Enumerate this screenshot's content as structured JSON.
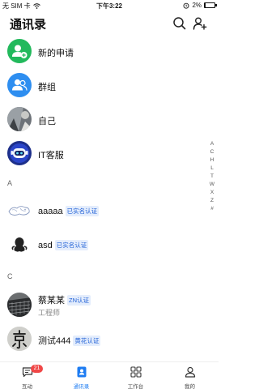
{
  "status_bar": {
    "carrier": "无 SIM 卡",
    "time": "下午3:22",
    "battery": "2%"
  },
  "header": {
    "title": "通讯录"
  },
  "quick_entries": [
    {
      "label": "新的申请",
      "icon": "add-person-icon",
      "color": "#22b95c"
    },
    {
      "label": "群组",
      "icon": "group-icon",
      "color": "#2e8ef0"
    },
    {
      "label": "自己",
      "icon": "photo-avatar"
    },
    {
      "label": "IT客服",
      "icon": "robot-avatar"
    }
  ],
  "sections": [
    {
      "letter": "A",
      "contacts": [
        {
          "name": "aaaaa",
          "tag": "已实名认证",
          "avatar": "sketch-avatar"
        },
        {
          "name": "asd",
          "tag": "已实名认证",
          "avatar": "penguin-avatar"
        }
      ]
    },
    {
      "letter": "C",
      "contacts": [
        {
          "name": "蔡某某",
          "tag": "ZN认证",
          "subtitle": "工程师",
          "avatar": "keyboard-photo-avatar"
        },
        {
          "name": "测试444",
          "tag": "黄花认证",
          "avatar": "jing-character-avatar"
        }
      ]
    }
  ],
  "index_letters": [
    "A",
    "C",
    "H",
    "L",
    "T",
    "W",
    "X",
    "Z",
    "#"
  ],
  "tab_bar": [
    {
      "label": "互动",
      "icon": "chat-icon",
      "badge": "21"
    },
    {
      "label": "通讯录",
      "icon": "contacts-icon",
      "active": true
    },
    {
      "label": "工作台",
      "icon": "grid-icon"
    },
    {
      "label": "我的",
      "icon": "person-icon"
    }
  ],
  "colors": {
    "accent": "#1e7cf2",
    "tag_text": "#1e5fd6",
    "tag_bg": "#e4edfc",
    "badge": "#f04747",
    "green": "#22b95c",
    "blue": "#2e8ef0"
  }
}
